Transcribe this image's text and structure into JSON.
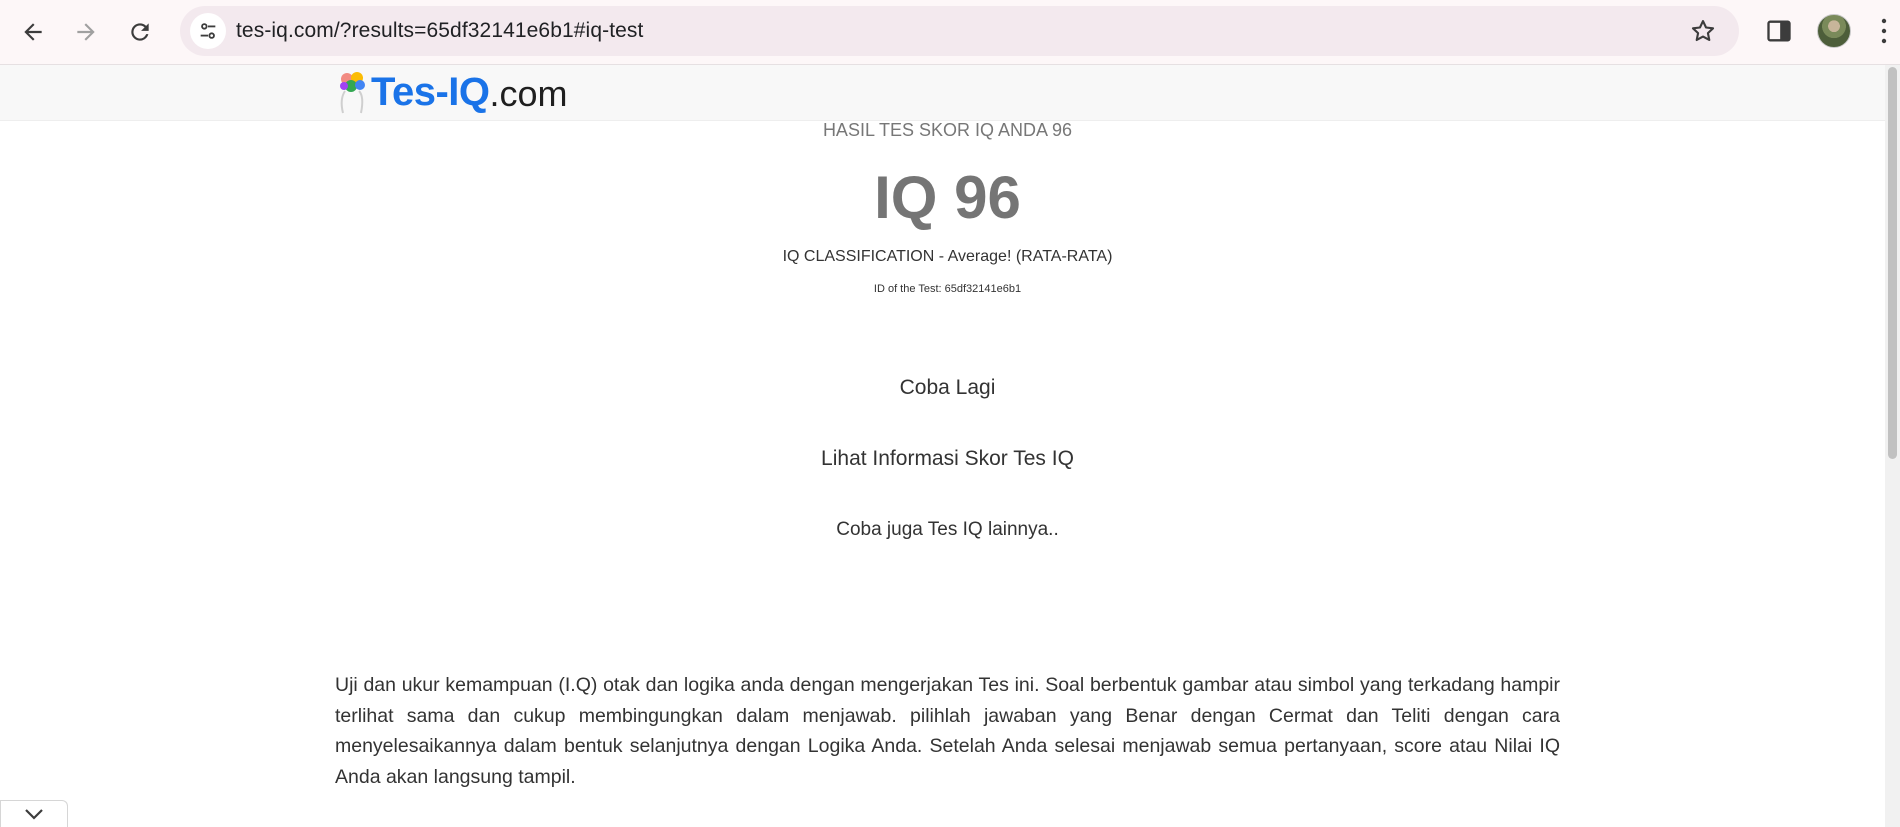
{
  "browser": {
    "url": "tes-iq.com/?results=65df32141e6b1#iq-test",
    "back_icon": "arrow-left-icon",
    "forward_icon": "arrow-right-icon",
    "reload_icon": "reload-icon",
    "site_info_icon": "tune-icon",
    "bookmark_icon": "star-icon",
    "side_panel_icon": "side-panel-icon",
    "menu_icon": "vertical-dots-icon"
  },
  "header": {
    "logo_main": "Tes-IQ",
    "logo_tld": ".com",
    "logo_icon": "brain-icon"
  },
  "result": {
    "heading": "HASIL TES SKOR IQ ANDA 96",
    "score": "IQ 96",
    "classification": "IQ CLASSIFICATION - Average! (RATA-RATA)",
    "test_id": "ID of the Test: 65df32141e6b1"
  },
  "actions": {
    "retry": "Coba Lagi",
    "info": "Lihat Informasi Skor Tes IQ",
    "other_tests": "Coba juga Tes IQ lainnya.."
  },
  "description": "Uji dan ukur kemampuan (I.Q) otak dan logika anda dengan mengerjakan Tes ini. Soal berbentuk gambar atau simbol yang terkadang hampir terlihat sama dan cukup membingungkan dalam menjawab. pilihlah jawaban yang Benar dengan Cermat dan Teliti dengan cara menyelesaikannya dalam bentuk selanjutnya dengan Logika Anda. Setelah Anda selesai menjawab semua pertanyaan, score atau Nilai IQ Anda akan langsung tampil.",
  "colors": {
    "logo_blue": "#1a73e8",
    "toolbar_bg": "#fdf7f8",
    "omnibox_bg": "#f3e9ee",
    "score_gray": "#757575"
  },
  "collapse_icon": "chevron-down-icon"
}
